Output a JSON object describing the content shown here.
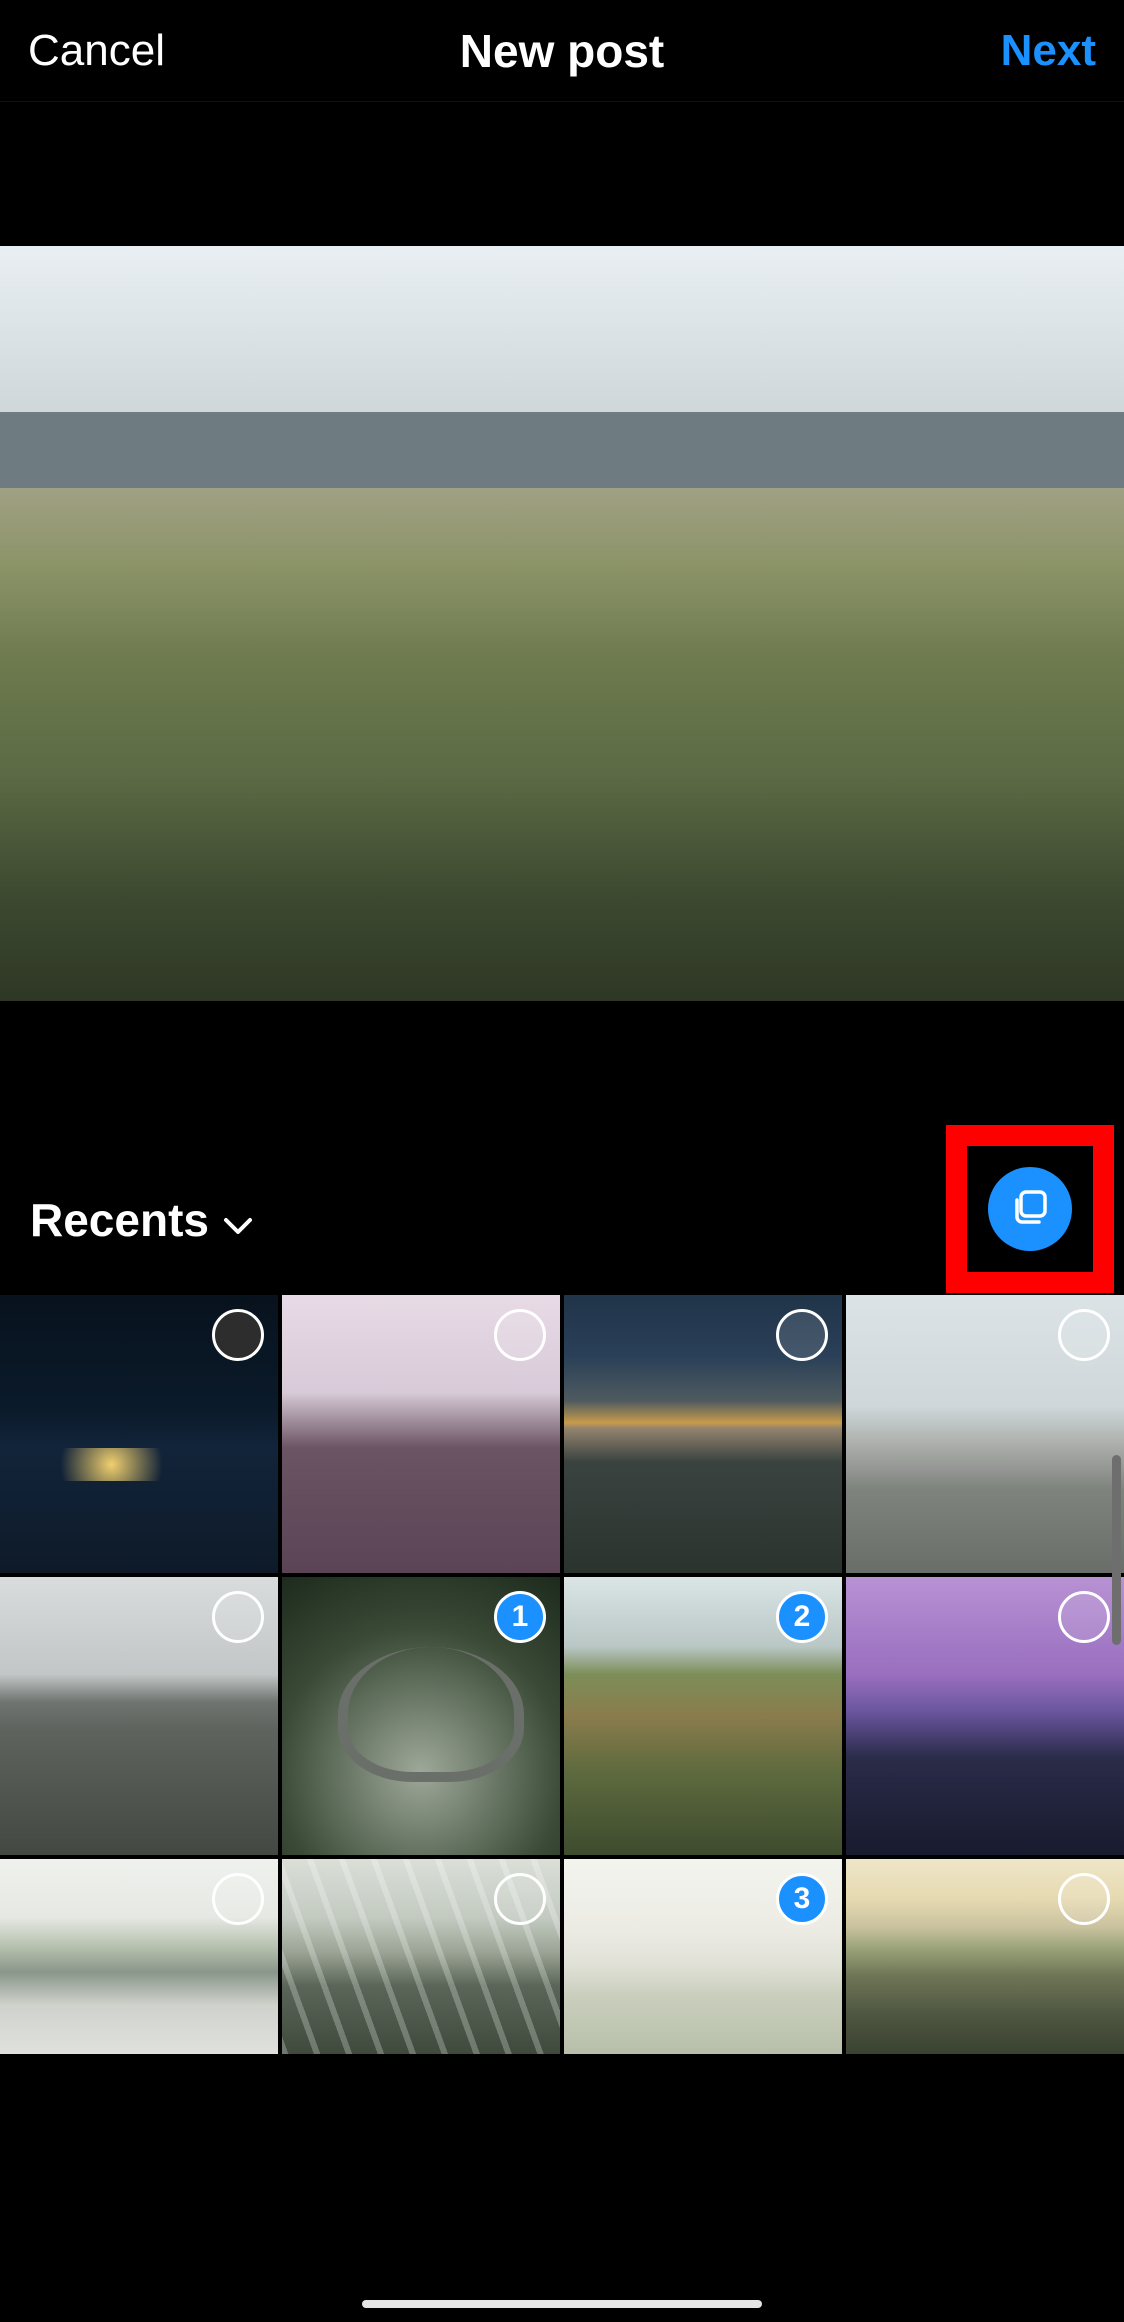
{
  "header": {
    "cancel_label": "Cancel",
    "title": "New post",
    "next_label": "Next"
  },
  "album": {
    "selected_label": "Recents"
  },
  "multi_select": {
    "active": true,
    "highlighted": true
  },
  "grid": {
    "thumbs": [
      {
        "desc": "night city lights by lake",
        "selected": false,
        "order": null
      },
      {
        "desc": "pink dawn over jagged mountains",
        "selected": false,
        "order": null
      },
      {
        "desc": "sunset clouds over town",
        "selected": false,
        "order": null
      },
      {
        "desc": "aerial wide city boulevard",
        "selected": false,
        "order": null
      },
      {
        "desc": "overcast grey mountain slope",
        "selected": false,
        "order": null
      },
      {
        "desc": "hairpin road in forest valley",
        "selected": true,
        "order": 1
      },
      {
        "desc": "hillside village terraces",
        "selected": true,
        "order": 2
      },
      {
        "desc": "purple dusk city skyline",
        "selected": false,
        "order": null
      },
      {
        "desc": "hazy green hills and city",
        "selected": false,
        "order": null
      },
      {
        "desc": "sun rays over mountain valley",
        "selected": false,
        "order": null
      },
      {
        "desc": "pale misty plain",
        "selected": true,
        "order": 3
      },
      {
        "desc": "golden aerial farmland settlement",
        "selected": false,
        "order": null
      }
    ]
  },
  "colors": {
    "accent": "#1b90ff",
    "highlight": "#ff0000"
  }
}
